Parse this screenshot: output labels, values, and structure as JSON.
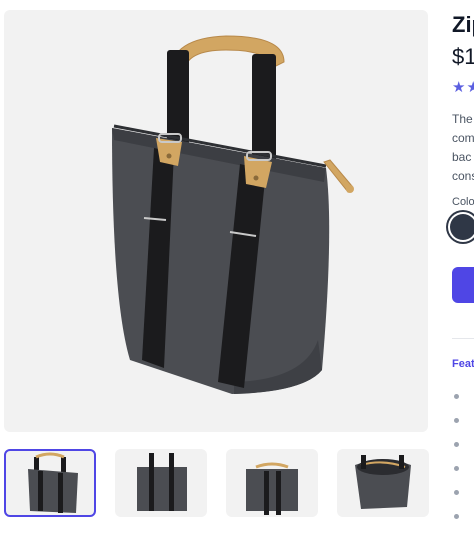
{
  "product": {
    "title": "Zip",
    "price": "$1",
    "rating_stars": "★★",
    "description_lines": [
      "The",
      "com",
      "bac",
      "cons"
    ],
    "color_label": "Colo",
    "selected_color": "#2f3746",
    "features_heading": "Feat"
  },
  "gallery": {
    "main_image": "gray-canvas-tote-bag",
    "thumbnails": [
      {
        "image": "tote-front-view",
        "selected": true
      },
      {
        "image": "tote-back-view",
        "selected": false
      },
      {
        "image": "tote-side-view",
        "selected": false
      },
      {
        "image": "tote-open-top-view",
        "selected": false
      }
    ]
  },
  "colors": {
    "accent": "#4f46e5",
    "bag_body": "#4b4d52",
    "strap": "#1b1b1d",
    "leather": "#d2a662"
  }
}
